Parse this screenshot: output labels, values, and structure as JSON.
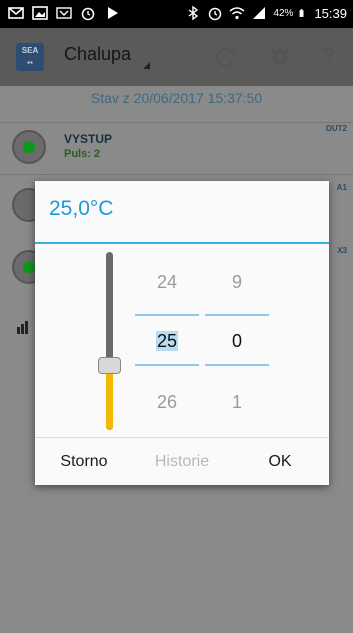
{
  "status_bar": {
    "battery": "42%",
    "time": "15:39",
    "left_icons": [
      "mail-icon",
      "image-icon",
      "missed-call-icon",
      "alarm-icon",
      "play-icon"
    ],
    "right_icons": [
      "bluetooth-icon",
      "alarm-icon",
      "wifi-icon",
      "signal-icon",
      "battery-icon"
    ]
  },
  "app": {
    "logo_text": "SEA",
    "title": "Chalupa",
    "status_text": "Stav z 20/06/2017 15:37:50",
    "rows": [
      {
        "title": "VYSTUP",
        "subtitle": "Puls: 2",
        "tag": "OUT2"
      },
      {
        "tag": "A1"
      },
      {
        "tag": "X3"
      }
    ]
  },
  "dialog": {
    "title": "25,0°C",
    "slider_fraction": 0.36,
    "integer_picker": {
      "prev": "24",
      "current": "25",
      "next": "26"
    },
    "decimal_picker": {
      "prev": "9",
      "current": "0",
      "next": "1"
    },
    "buttons": {
      "cancel": "Storno",
      "history": "Historie",
      "ok": "OK"
    }
  }
}
